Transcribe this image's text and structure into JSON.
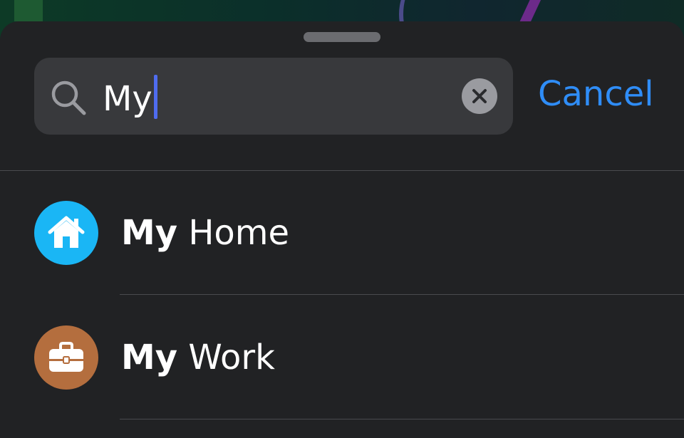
{
  "search": {
    "query": "My",
    "cancel_label": "Cancel"
  },
  "results": [
    {
      "match": "My",
      "rest": " Home",
      "icon": "house-icon",
      "icon_color": "#1ab6f5"
    },
    {
      "match": "My",
      "rest": " Work",
      "icon": "briefcase-icon",
      "icon_color": "#b46e3e"
    }
  ],
  "colors": {
    "accent": "#2f8df7",
    "caret": "#4f6cf0",
    "sheet_background": "#212224",
    "field_background": "#38393c"
  }
}
